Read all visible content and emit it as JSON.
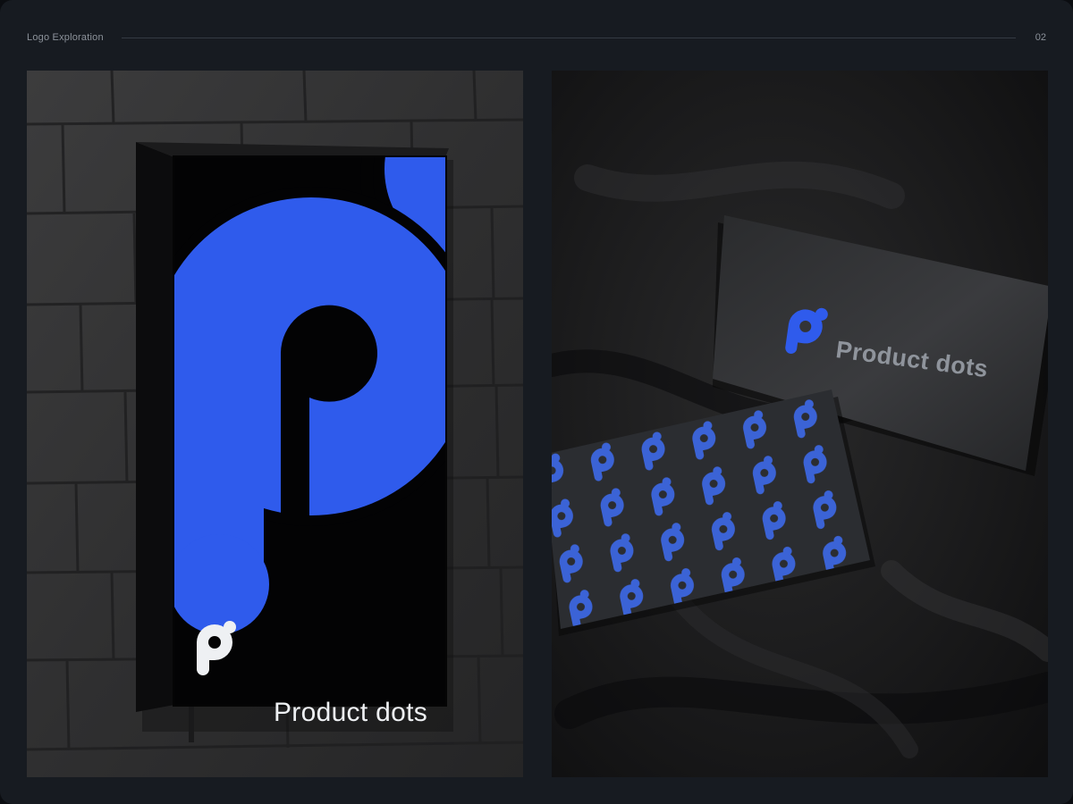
{
  "header": {
    "title": "Logo Exploration",
    "page_number": "02"
  },
  "brand": {
    "name": "Product dots",
    "accent_color": "#2f5bec",
    "sign_wordmark_color": "#eef0f3",
    "card_wordmark_color": "#8f949c"
  },
  "panels": [
    {
      "name": "lightbox-sign-mockup",
      "icon": "p-dot-logo-icon"
    },
    {
      "name": "business-cards-mockup",
      "icon": "p-dot-logo-icon"
    }
  ]
}
